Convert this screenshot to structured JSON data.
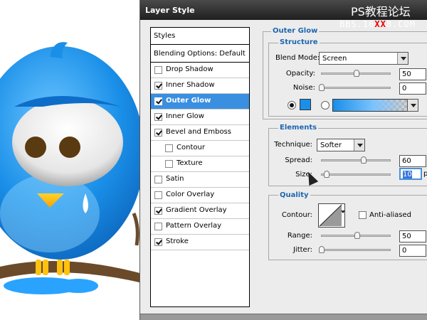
{
  "dialog": {
    "title": "Layer Style",
    "watermark": "PS教程论坛",
    "watermark_sub_a": "BBS.16",
    "watermark_sub_b": "XX",
    "watermark_sub_c": "8.COM"
  },
  "styles_list": {
    "items": [
      {
        "label": "Styles",
        "has_checkbox": false,
        "checked": false
      },
      {
        "label": "Blending Options: Default",
        "has_checkbox": false,
        "checked": false
      },
      {
        "label": "Drop Shadow",
        "has_checkbox": true,
        "checked": false
      },
      {
        "label": "Inner Shadow",
        "has_checkbox": true,
        "checked": true
      },
      {
        "label": "Outer Glow",
        "has_checkbox": true,
        "checked": true,
        "selected": true
      },
      {
        "label": "Inner Glow",
        "has_checkbox": true,
        "checked": true
      },
      {
        "label": "Bevel and Emboss",
        "has_checkbox": true,
        "checked": true
      },
      {
        "label": "Contour",
        "has_checkbox": true,
        "checked": false,
        "indent": true
      },
      {
        "label": "Texture",
        "has_checkbox": true,
        "checked": false,
        "indent": true
      },
      {
        "label": "Satin",
        "has_checkbox": true,
        "checked": false
      },
      {
        "label": "Color Overlay",
        "has_checkbox": true,
        "checked": false
      },
      {
        "label": "Gradient Overlay",
        "has_checkbox": true,
        "checked": true
      },
      {
        "label": "Pattern Overlay",
        "has_checkbox": true,
        "checked": false
      },
      {
        "label": "Stroke",
        "has_checkbox": true,
        "checked": true
      }
    ]
  },
  "outer_glow": {
    "section_title": "Outer Glow",
    "structure": {
      "title": "Structure",
      "blend_mode_label": "Blend Mode:",
      "blend_mode_value": "Screen",
      "opacity_label": "Opacity:",
      "opacity_value": "50",
      "opacity_level": 0.5,
      "noise_label": "Noise:",
      "noise_value": "0",
      "noise_level": 0.0,
      "color_swatch": "#1a8fe8",
      "color_radio_selected": true,
      "gradient_radio_selected": false
    },
    "elements": {
      "title": "Elements",
      "technique_label": "Technique:",
      "technique_value": "Softer",
      "spread_label": "Spread:",
      "spread_value": "60",
      "spread_level": 0.6,
      "size_label": "Size:",
      "size_value": "10",
      "size_unit": "p",
      "size_level": 0.04
    },
    "quality": {
      "title": "Quality",
      "contour_label": "Contour:",
      "anti_aliased_label": "Anti-aliased",
      "anti_aliased_checked": false,
      "range_label": "Range:",
      "range_value": "50",
      "range_level": 0.5,
      "jitter_label": "Jitter:",
      "jitter_value": "0",
      "jitter_level": 0.0
    }
  },
  "colors": {
    "selected_row": "#3a8fe0",
    "section_title": "#1e66b0",
    "bird_blue": "#1a8fe8"
  }
}
